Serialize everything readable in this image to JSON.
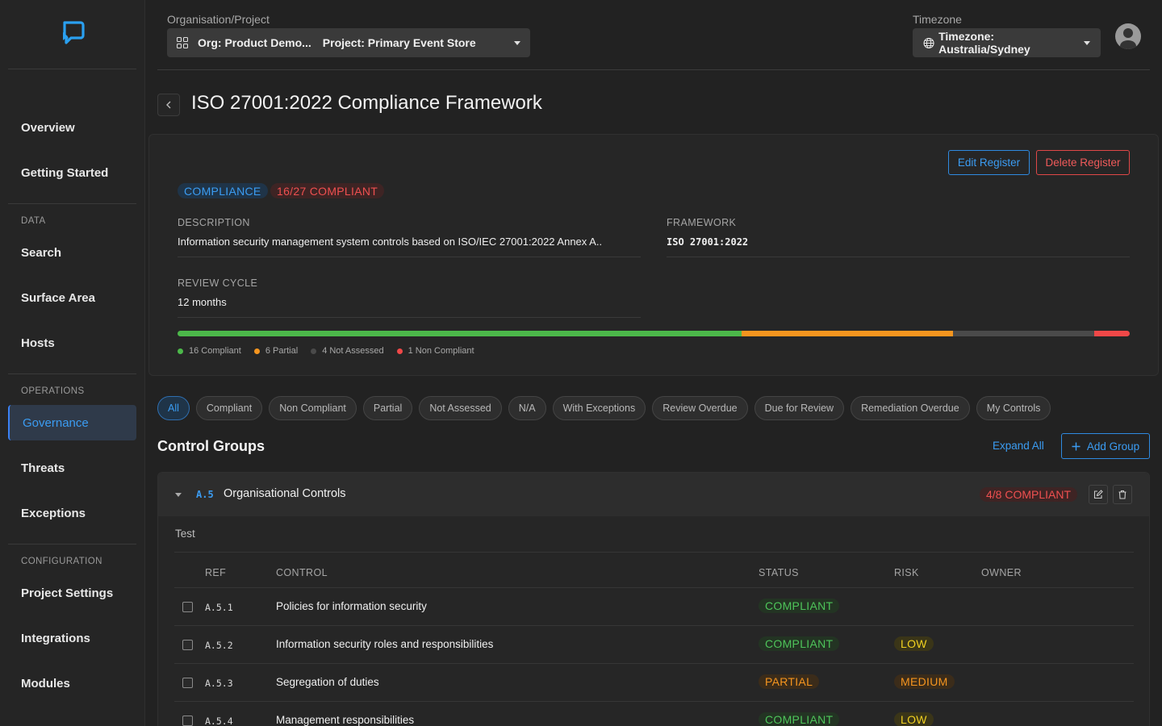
{
  "sidebar": {
    "items": [
      {
        "label": "Overview"
      },
      {
        "label": "Getting Started"
      },
      {
        "label": "Search"
      },
      {
        "label": "Surface Area"
      },
      {
        "label": "Hosts"
      },
      {
        "label": "Governance"
      },
      {
        "label": "Threats"
      },
      {
        "label": "Exceptions"
      },
      {
        "label": "Project Settings"
      },
      {
        "label": "Integrations"
      },
      {
        "label": "Modules"
      }
    ],
    "sections": {
      "data": "DATA",
      "operations": "OPERATIONS",
      "configuration": "CONFIGURATION"
    },
    "active": "Governance"
  },
  "topbar": {
    "org_label": "Organisation/Project",
    "org_value": "Org: Product Demo...",
    "project_value": "Project: Primary Event Store",
    "tz_label": "Timezone",
    "tz_value": "Timezone: Australia/Sydney"
  },
  "page": {
    "title": "ISO 27001:2022 Compliance Framework"
  },
  "register": {
    "edit_label": "Edit Register",
    "delete_label": "Delete Register",
    "type_badge": "COMPLIANCE",
    "compliance_badge": "16/27 COMPLIANT",
    "description_label": "DESCRIPTION",
    "description": "Information security management system controls based on ISO/IEC 27001:2022 Annex A..",
    "framework_label": "FRAMEWORK",
    "framework": "ISO 27001:2022",
    "review_label": "REVIEW CYCLE",
    "review": "12 months",
    "progress": [
      {
        "label": "16 Compliant",
        "count": 16,
        "color": "#4cb84a"
      },
      {
        "label": "6 Partial",
        "count": 6,
        "color": "#f5951f"
      },
      {
        "label": "4 Not Assessed",
        "count": 4,
        "color": "#4a4a4a"
      },
      {
        "label": "1 Non Compliant",
        "count": 1,
        "color": "#f04848"
      }
    ]
  },
  "filters": [
    "All",
    "Compliant",
    "Non Compliant",
    "Partial",
    "Not Assessed",
    "N/A",
    "With Exceptions",
    "Review Overdue",
    "Due for Review",
    "Remediation Overdue",
    "My Controls"
  ],
  "active_filter": "All",
  "groups_section": {
    "title": "Control Groups",
    "expand_all": "Expand All",
    "add_group": "Add Group"
  },
  "group": {
    "ref": "A.5",
    "name": "Organisational Controls",
    "badge": "4/8 COMPLIANT",
    "description": "Test",
    "columns": {
      "ref": "REF",
      "control": "CONTROL",
      "status": "STATUS",
      "risk": "RISK",
      "owner": "OWNER"
    },
    "rows": [
      {
        "ref": "A.5.1",
        "control": "Policies for information security",
        "status": "COMPLIANT",
        "risk": ""
      },
      {
        "ref": "A.5.2",
        "control": "Information security roles and responsibilities",
        "status": "COMPLIANT",
        "risk": "LOW"
      },
      {
        "ref": "A.5.3",
        "control": "Segregation of duties",
        "status": "PARTIAL",
        "risk": "MEDIUM"
      },
      {
        "ref": "A.5.4",
        "control": "Management responsibilities",
        "status": "COMPLIANT",
        "risk": "LOW"
      }
    ]
  }
}
